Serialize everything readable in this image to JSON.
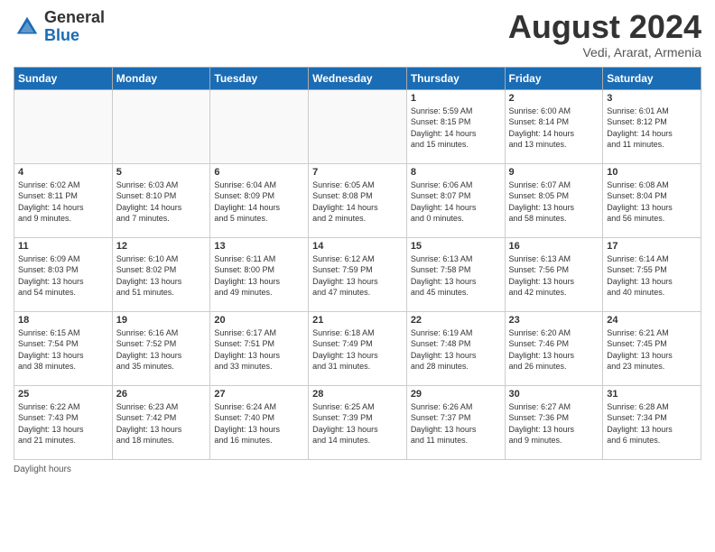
{
  "header": {
    "logo_general": "General",
    "logo_blue": "Blue",
    "month_title": "August 2024",
    "location": "Vedi, Ararat, Armenia"
  },
  "days_of_week": [
    "Sunday",
    "Monday",
    "Tuesday",
    "Wednesday",
    "Thursday",
    "Friday",
    "Saturday"
  ],
  "footer": {
    "daylight_label": "Daylight hours"
  },
  "weeks": [
    [
      {
        "day": "",
        "info": ""
      },
      {
        "day": "",
        "info": ""
      },
      {
        "day": "",
        "info": ""
      },
      {
        "day": "",
        "info": ""
      },
      {
        "day": "1",
        "info": "Sunrise: 5:59 AM\nSunset: 8:15 PM\nDaylight: 14 hours\nand 15 minutes."
      },
      {
        "day": "2",
        "info": "Sunrise: 6:00 AM\nSunset: 8:14 PM\nDaylight: 14 hours\nand 13 minutes."
      },
      {
        "day": "3",
        "info": "Sunrise: 6:01 AM\nSunset: 8:12 PM\nDaylight: 14 hours\nand 11 minutes."
      }
    ],
    [
      {
        "day": "4",
        "info": "Sunrise: 6:02 AM\nSunset: 8:11 PM\nDaylight: 14 hours\nand 9 minutes."
      },
      {
        "day": "5",
        "info": "Sunrise: 6:03 AM\nSunset: 8:10 PM\nDaylight: 14 hours\nand 7 minutes."
      },
      {
        "day": "6",
        "info": "Sunrise: 6:04 AM\nSunset: 8:09 PM\nDaylight: 14 hours\nand 5 minutes."
      },
      {
        "day": "7",
        "info": "Sunrise: 6:05 AM\nSunset: 8:08 PM\nDaylight: 14 hours\nand 2 minutes."
      },
      {
        "day": "8",
        "info": "Sunrise: 6:06 AM\nSunset: 8:07 PM\nDaylight: 14 hours\nand 0 minutes."
      },
      {
        "day": "9",
        "info": "Sunrise: 6:07 AM\nSunset: 8:05 PM\nDaylight: 13 hours\nand 58 minutes."
      },
      {
        "day": "10",
        "info": "Sunrise: 6:08 AM\nSunset: 8:04 PM\nDaylight: 13 hours\nand 56 minutes."
      }
    ],
    [
      {
        "day": "11",
        "info": "Sunrise: 6:09 AM\nSunset: 8:03 PM\nDaylight: 13 hours\nand 54 minutes."
      },
      {
        "day": "12",
        "info": "Sunrise: 6:10 AM\nSunset: 8:02 PM\nDaylight: 13 hours\nand 51 minutes."
      },
      {
        "day": "13",
        "info": "Sunrise: 6:11 AM\nSunset: 8:00 PM\nDaylight: 13 hours\nand 49 minutes."
      },
      {
        "day": "14",
        "info": "Sunrise: 6:12 AM\nSunset: 7:59 PM\nDaylight: 13 hours\nand 47 minutes."
      },
      {
        "day": "15",
        "info": "Sunrise: 6:13 AM\nSunset: 7:58 PM\nDaylight: 13 hours\nand 45 minutes."
      },
      {
        "day": "16",
        "info": "Sunrise: 6:13 AM\nSunset: 7:56 PM\nDaylight: 13 hours\nand 42 minutes."
      },
      {
        "day": "17",
        "info": "Sunrise: 6:14 AM\nSunset: 7:55 PM\nDaylight: 13 hours\nand 40 minutes."
      }
    ],
    [
      {
        "day": "18",
        "info": "Sunrise: 6:15 AM\nSunset: 7:54 PM\nDaylight: 13 hours\nand 38 minutes."
      },
      {
        "day": "19",
        "info": "Sunrise: 6:16 AM\nSunset: 7:52 PM\nDaylight: 13 hours\nand 35 minutes."
      },
      {
        "day": "20",
        "info": "Sunrise: 6:17 AM\nSunset: 7:51 PM\nDaylight: 13 hours\nand 33 minutes."
      },
      {
        "day": "21",
        "info": "Sunrise: 6:18 AM\nSunset: 7:49 PM\nDaylight: 13 hours\nand 31 minutes."
      },
      {
        "day": "22",
        "info": "Sunrise: 6:19 AM\nSunset: 7:48 PM\nDaylight: 13 hours\nand 28 minutes."
      },
      {
        "day": "23",
        "info": "Sunrise: 6:20 AM\nSunset: 7:46 PM\nDaylight: 13 hours\nand 26 minutes."
      },
      {
        "day": "24",
        "info": "Sunrise: 6:21 AM\nSunset: 7:45 PM\nDaylight: 13 hours\nand 23 minutes."
      }
    ],
    [
      {
        "day": "25",
        "info": "Sunrise: 6:22 AM\nSunset: 7:43 PM\nDaylight: 13 hours\nand 21 minutes."
      },
      {
        "day": "26",
        "info": "Sunrise: 6:23 AM\nSunset: 7:42 PM\nDaylight: 13 hours\nand 18 minutes."
      },
      {
        "day": "27",
        "info": "Sunrise: 6:24 AM\nSunset: 7:40 PM\nDaylight: 13 hours\nand 16 minutes."
      },
      {
        "day": "28",
        "info": "Sunrise: 6:25 AM\nSunset: 7:39 PM\nDaylight: 13 hours\nand 14 minutes."
      },
      {
        "day": "29",
        "info": "Sunrise: 6:26 AM\nSunset: 7:37 PM\nDaylight: 13 hours\nand 11 minutes."
      },
      {
        "day": "30",
        "info": "Sunrise: 6:27 AM\nSunset: 7:36 PM\nDaylight: 13 hours\nand 9 minutes."
      },
      {
        "day": "31",
        "info": "Sunrise: 6:28 AM\nSunset: 7:34 PM\nDaylight: 13 hours\nand 6 minutes."
      }
    ]
  ]
}
